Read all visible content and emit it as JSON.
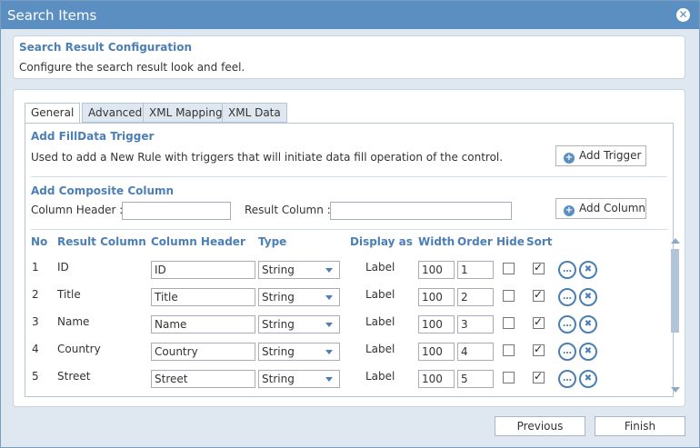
{
  "window": {
    "title": "Search Items",
    "close": "✕"
  },
  "info": {
    "heading": "Search Result Configuration",
    "description": "Configure the search result look and feel."
  },
  "tabs": [
    {
      "label": "General",
      "active": true
    },
    {
      "label": "Advanced"
    },
    {
      "label": "XML Mapping"
    },
    {
      "label": "XML Data"
    }
  ],
  "filldata": {
    "heading": "Add FillData Trigger",
    "description": "Used to add a New Rule with triggers that will initiate data fill operation of the control.",
    "button": "Add Trigger"
  },
  "composite": {
    "heading": "Add Composite Column",
    "column_header_label": "Column Header :",
    "column_header_value": "",
    "result_column_label": "Result Column :",
    "result_column_value": "",
    "button": "Add Column"
  },
  "table": {
    "headers": {
      "no": "No",
      "result": "Result Column",
      "colheader": "Column Header",
      "type": "Type",
      "display": "Display as",
      "width": "Width",
      "order": "Order",
      "hide": "Hide",
      "sort": "Sort"
    },
    "rows": [
      {
        "no": "1",
        "result": "ID",
        "colheader": "ID",
        "type": "String",
        "display": "Label",
        "width": "100",
        "order": "1",
        "hide": false,
        "sort": true
      },
      {
        "no": "2",
        "result": "Title",
        "colheader": "Title",
        "type": "String",
        "display": "Label",
        "width": "100",
        "order": "2",
        "hide": false,
        "sort": true
      },
      {
        "no": "3",
        "result": "Name",
        "colheader": "Name",
        "type": "String",
        "display": "Label",
        "width": "100",
        "order": "3",
        "hide": false,
        "sort": true
      },
      {
        "no": "4",
        "result": "Country",
        "colheader": "Country",
        "type": "String",
        "display": "Label",
        "width": "100",
        "order": "4",
        "hide": false,
        "sort": true
      },
      {
        "no": "5",
        "result": "Street",
        "colheader": "Street",
        "type": "String",
        "display": "Label",
        "width": "100",
        "order": "5",
        "hide": false,
        "sort": true
      }
    ]
  },
  "footer": {
    "previous": "Previous",
    "finish": "Finish"
  },
  "colors": {
    "titlebar": "#5b8ec1",
    "heading": "#4b7fb5",
    "background": "#dfe8f1"
  }
}
